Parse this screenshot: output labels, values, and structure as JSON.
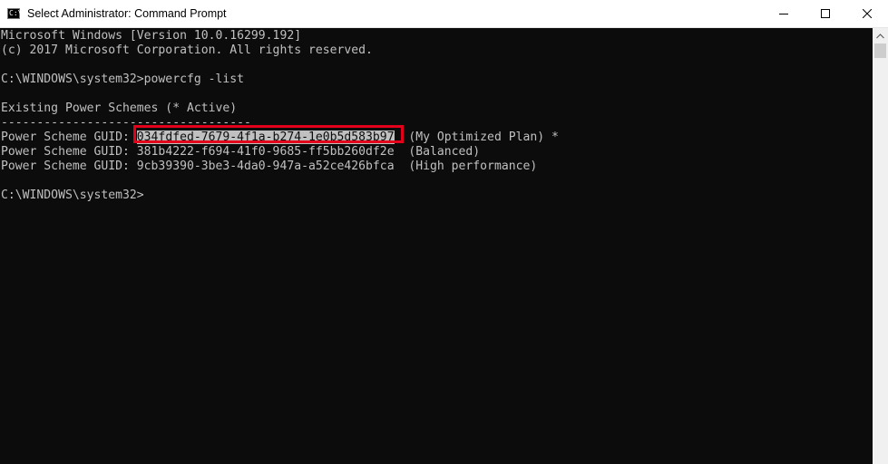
{
  "window": {
    "title": "Select Administrator: Command Prompt",
    "icon": "command-prompt-icon",
    "icon_glyph": "C:\\",
    "controls": [
      "minimize-icon",
      "maximize-icon",
      "close-icon"
    ]
  },
  "console": {
    "lines": [
      "Microsoft Windows [Version 10.0.16299.192]",
      "(c) 2017 Microsoft Corporation. All rights reserved.",
      "",
      "C:\\WINDOWS\\system32>powercfg -list",
      "",
      "Existing Power Schemes (* Active)",
      "-----------------------------------"
    ],
    "schemes": [
      {
        "prefix": "Power Scheme GUID: ",
        "guid": "034fdfed-7679-4f1a-b274-1e0b5d583b97",
        "name": "  (My Optimized Plan) *"
      },
      {
        "prefix": "Power Scheme GUID: ",
        "guid": "381b4222-f694-41f0-9685-ff5bb260df2e",
        "name": "  (Balanced)"
      },
      {
        "prefix": "Power Scheme GUID: ",
        "guid": "9cb39390-3be3-4da0-947a-a52ce426bfca",
        "name": "  (High performance)"
      }
    ],
    "prompt": "C:\\WINDOWS\\system32>"
  },
  "colors": {
    "console_background": "#0c0c0c",
    "console_text": "#c0c0c0",
    "highlight_box": "#e3001b"
  }
}
